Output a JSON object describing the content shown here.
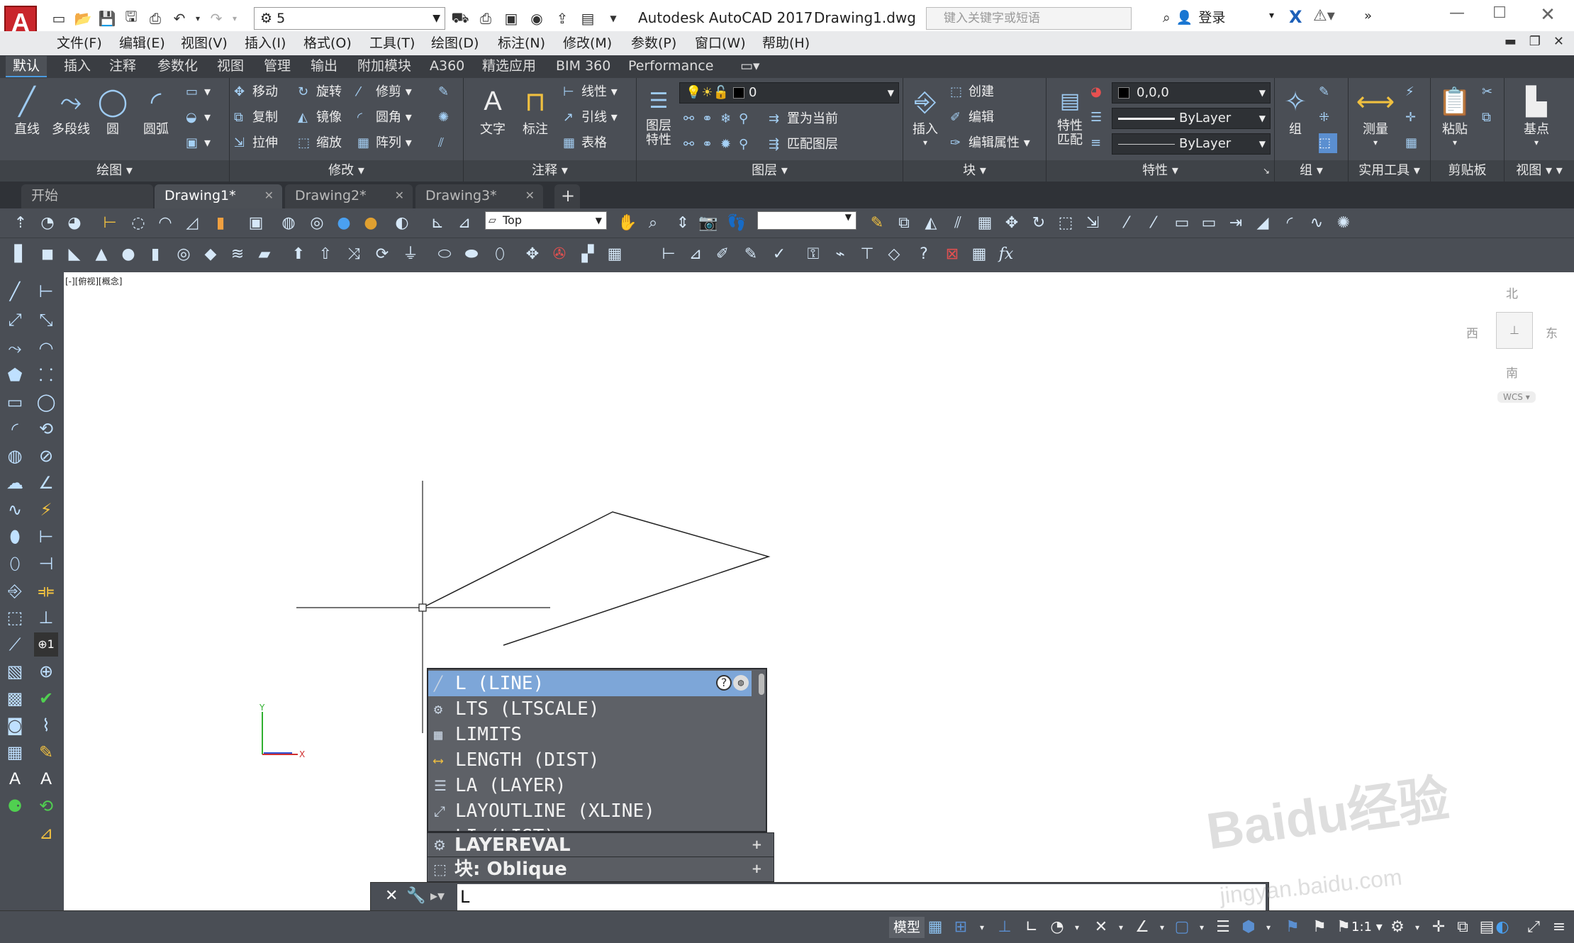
{
  "titlebar": {
    "workspace_value": "5",
    "app_title": "Autodesk AutoCAD 2017",
    "doc_title": "Drawing1.dwg",
    "search_placeholder": "键入关键字或短语",
    "login_label": "登录"
  },
  "menubar": {
    "items": [
      "文件(F)",
      "编辑(E)",
      "视图(V)",
      "插入(I)",
      "格式(O)",
      "工具(T)",
      "绘图(D)",
      "标注(N)",
      "修改(M)",
      "参数(P)",
      "窗口(W)",
      "帮助(H)"
    ]
  },
  "ribbon_tabs": {
    "items": [
      "默认",
      "插入",
      "注释",
      "参数化",
      "视图",
      "管理",
      "输出",
      "附加模块",
      "A360",
      "精选应用",
      "BIM 360",
      "Performance"
    ],
    "active": "默认"
  },
  "ribbon": {
    "draw": {
      "title": "绘图",
      "line": "直线",
      "polyline": "多段线",
      "circle": "圆",
      "arc": "圆弧"
    },
    "modify": {
      "title": "修改",
      "move": "移动",
      "rotate": "旋转",
      "trim": "修剪",
      "copy": "复制",
      "mirror": "镜像",
      "fillet": "圆角",
      "stretch": "拉伸",
      "scale": "缩放",
      "array": "阵列"
    },
    "annotation": {
      "title": "注释",
      "text": "文字",
      "dimension": "标注",
      "linear": "线性",
      "leader": "引线",
      "table": "表格"
    },
    "layers": {
      "title": "图层",
      "layer_props_1": "图层",
      "layer_props_2": "特性",
      "layer_value": "0",
      "set_current": "置为当前",
      "match_layer": "匹配图层"
    },
    "block": {
      "title": "块",
      "insert": "插入",
      "create": "创建",
      "edit": "编辑",
      "edit_attr": "编辑属性"
    },
    "properties": {
      "title": "特性",
      "match_1": "特性",
      "match_2": "匹配",
      "color_value": "0,0,0",
      "linetype_value": "ByLayer",
      "lineweight_value": "ByLayer"
    },
    "groups": {
      "title": "组",
      "group": "组"
    },
    "utilities": {
      "title": "实用工具",
      "measure": "测量"
    },
    "clipboard": {
      "title": "剪贴板",
      "paste": "粘贴"
    },
    "view": {
      "title": "视图",
      "basepoint": "基点"
    }
  },
  "doc_tabs": {
    "items": [
      "开始",
      "Drawing1*",
      "Drawing2*",
      "Drawing3*"
    ],
    "active": "Drawing1*"
  },
  "toolbar1": {
    "view_value": "Top"
  },
  "canvas": {
    "viewport_label": "[-][俯视][概念]",
    "viewcube": {
      "north": "北",
      "south": "南",
      "east": "东",
      "west": "西",
      "wcs": "WCS"
    }
  },
  "autocomplete": {
    "items": [
      {
        "label": "L (LINE)",
        "icon": "line-icon"
      },
      {
        "label": "LTS (LTSCALE)",
        "icon": "gear-icon"
      },
      {
        "label": "LIMITS",
        "icon": "grid-icon"
      },
      {
        "label": "LENGTH (DIST)",
        "icon": "ruler-icon"
      },
      {
        "label": "LA (LAYER)",
        "icon": "layer-icon"
      },
      {
        "label": "LAYOUTLINE (XLINE)",
        "icon": "xline-icon"
      },
      {
        "label": "LI (LIST)",
        "icon": "list-icon"
      }
    ],
    "extra": [
      "LAYEREVAL",
      "块:  Oblique"
    ]
  },
  "cmdline": {
    "value": "L"
  },
  "statusbar": {
    "model_label": "模型",
    "scale_label": "1:1"
  },
  "watermark": {
    "text": "Baidu经验",
    "url_text": "jingyan.baidu.com"
  }
}
